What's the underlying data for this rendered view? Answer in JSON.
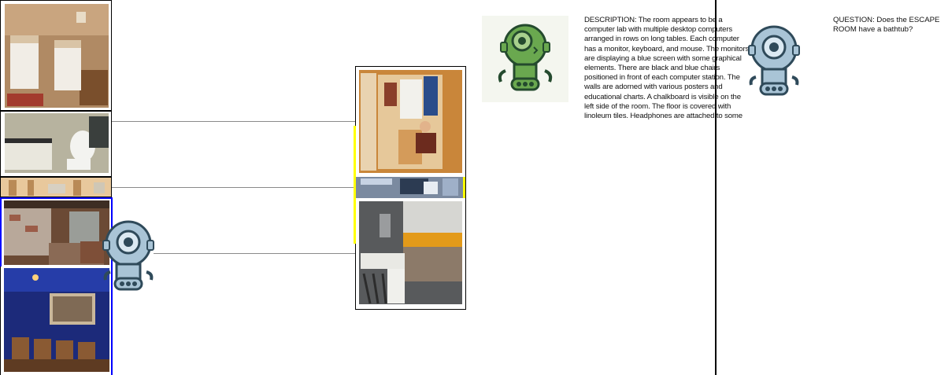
{
  "description": {
    "text": "DESCRIPTION: The room appears to be a computer lab with multiple desktop computers arranged in rows on long tables. Each computer has a monitor, keyboard, and mouse. The monitors are displaying a blue screen with some graphical elements. There are black and blue chairs positioned in front of each computer station. The walls are adorned with various posters and educational charts. A chalkboard is visible on the left side of the room. The floor is covered with linoleum tiles. Headphones are attached to some"
  },
  "question": {
    "text": "QUESTION: Does the ESCAPE ROOM have a bathtub?"
  },
  "rooms_left": [
    {
      "name": "bedroom"
    },
    {
      "name": "bathroom"
    },
    {
      "name": "computer-lab"
    },
    {
      "name": "basement"
    },
    {
      "name": "home-theater"
    }
  ],
  "rooms_right": [
    {
      "name": "closet"
    },
    {
      "name": "computer-lab"
    },
    {
      "name": "kitchen"
    }
  ],
  "colors": {
    "selected_border": "#0000ff",
    "highlight_border": "#ffff00",
    "robot_green": "#6aa84f",
    "robot_blue": "#a9c4d6"
  }
}
